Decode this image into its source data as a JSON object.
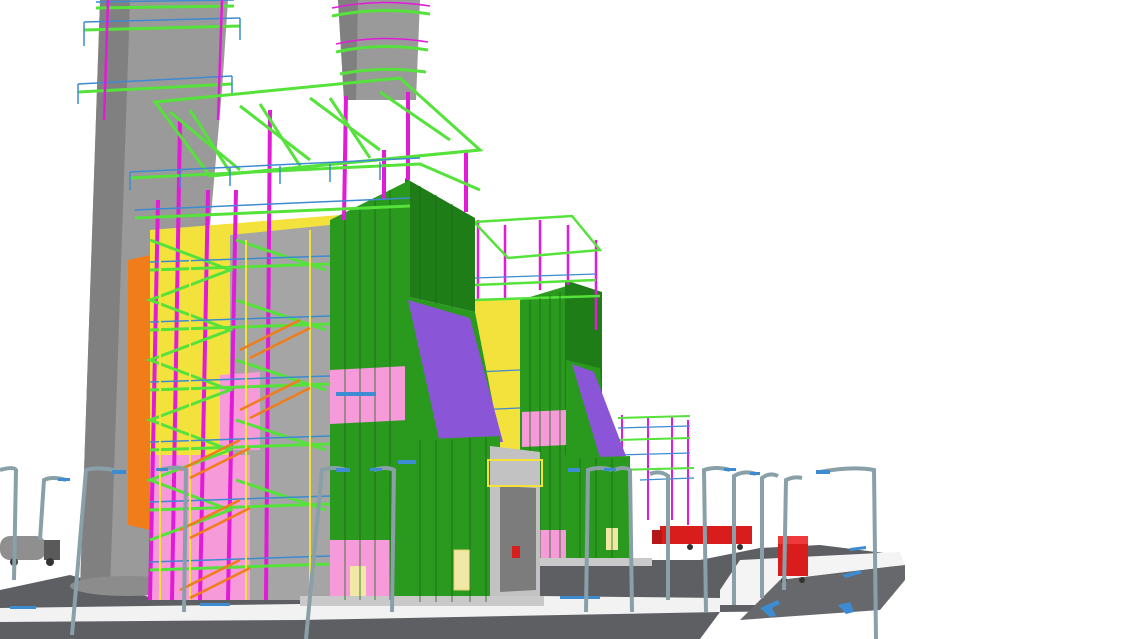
{
  "scene": {
    "kind": "3d-plant-model",
    "palette": {
      "background": "#ffffff",
      "panel_green": "#2a9a1f",
      "panel_green_dark": "#1f7d18",
      "panel_pink": "#f79ad9",
      "roof_purple": "#8a55d6",
      "frame_magenta": "#e21bd8",
      "frame_green": "#55e23a",
      "rail_blue": "#3d8bd0",
      "stair_orange": "#f07d1a",
      "chimney_grey": "#9a9a9a",
      "road_grey": "#5d5f63",
      "pole_grey": "#8aa0a8",
      "truck_red": "#d91c1c",
      "column_yellow": "#f4e23c"
    },
    "vehicles": {
      "trailer_text_lines": [
        "",
        ""
      ]
    }
  }
}
